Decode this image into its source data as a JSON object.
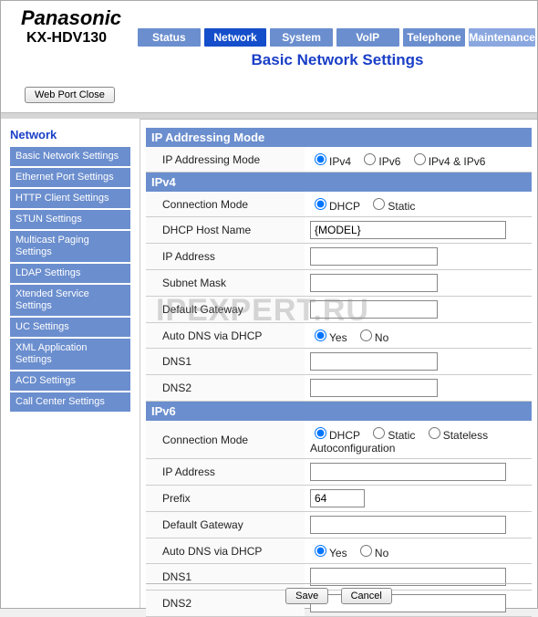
{
  "brand": "Panasonic",
  "model": "KX-HDV130",
  "tabs": [
    "Status",
    "Network",
    "System",
    "VoIP",
    "Telephone",
    "Maintenance"
  ],
  "active_tab": "Network",
  "page_title": "Basic Network Settings",
  "web_port_close": "Web Port Close",
  "watermark": "IPEXPERT.RU",
  "sidebar_title": "Network",
  "sidebar_items": [
    "Basic Network Settings",
    "Ethernet Port Settings",
    "HTTP Client Settings",
    "STUN Settings",
    "Multicast Paging Settings",
    "LDAP Settings",
    "Xtended Service Settings",
    "UC Settings",
    "XML Application Settings",
    "ACD Settings",
    "Call Center Settings"
  ],
  "sections": {
    "ip_addressing_mode_header": "IP Addressing Mode",
    "ipv4_header": "IPv4",
    "ipv6_header": "IPv6"
  },
  "labels": {
    "ip_addressing_mode": "IP Addressing Mode",
    "connection_mode": "Connection Mode",
    "dhcp_host_name": "DHCP Host Name",
    "ip_address": "IP Address",
    "subnet_mask": "Subnet Mask",
    "default_gateway": "Default Gateway",
    "auto_dns_via_dhcp": "Auto DNS via DHCP",
    "dns1": "DNS1",
    "dns2": "DNS2",
    "prefix": "Prefix"
  },
  "options": {
    "ip_addressing_mode": [
      "IPv4",
      "IPv6",
      "IPv4 & IPv6"
    ],
    "ipv4_connection_mode": [
      "DHCP",
      "Static"
    ],
    "ipv6_connection_mode": [
      "DHCP",
      "Static",
      "Stateless Autoconfiguration"
    ],
    "yes_no": [
      "Yes",
      "No"
    ]
  },
  "values": {
    "ip_addressing_mode": "IPv4",
    "ipv4": {
      "connection_mode": "DHCP",
      "dhcp_host_name": "{MODEL}",
      "ip_address": "",
      "subnet_mask": "",
      "default_gateway": "",
      "auto_dns_via_dhcp": "Yes",
      "dns1": "",
      "dns2": ""
    },
    "ipv6": {
      "connection_mode": "DHCP",
      "ip_address": "",
      "prefix": "64",
      "default_gateway": "",
      "auto_dns_via_dhcp": "Yes",
      "dns1": "",
      "dns2": ""
    }
  },
  "buttons": {
    "save": "Save",
    "cancel": "Cancel"
  }
}
